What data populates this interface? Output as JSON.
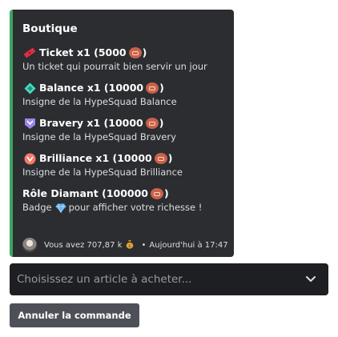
{
  "embed": {
    "title": "Boutique",
    "accent_color": "#3ba55d",
    "items": [
      {
        "icon": "ticket-icon",
        "name": "Ticket x1 (5000",
        "close": ")",
        "description": "Un ticket qui pourrait bien servir un jour"
      },
      {
        "icon": "hypesquad-balance-icon",
        "name": "Balance x1 (10000",
        "close": ")",
        "description": "Insigne de la HypeSquad Balance"
      },
      {
        "icon": "hypesquad-bravery-icon",
        "name": "Bravery x1 (10000",
        "close": ")",
        "description": "Insigne de la HypeSquad Bravery"
      },
      {
        "icon": "hypesquad-brilliance-icon",
        "name": "Brilliance x1 (10000",
        "close": ")",
        "description": "Insigne de la HypeSquad Brilliance"
      },
      {
        "icon": "",
        "name": "Rôle  Diamant (100000",
        "close": ")",
        "description_pre": "Badge",
        "description_icon": "diamond-icon",
        "description_post": "pour afficher votre richesse !"
      }
    ],
    "footer": {
      "balance_text": "Vous avez 707,87 k",
      "money_icon": "money-bag-icon",
      "timestamp": "Aujourd'hui à 17:47"
    }
  },
  "select": {
    "placeholder": "Choisissez un article à acheter..."
  },
  "cancel_button": {
    "label": "Annuler la commande"
  }
}
